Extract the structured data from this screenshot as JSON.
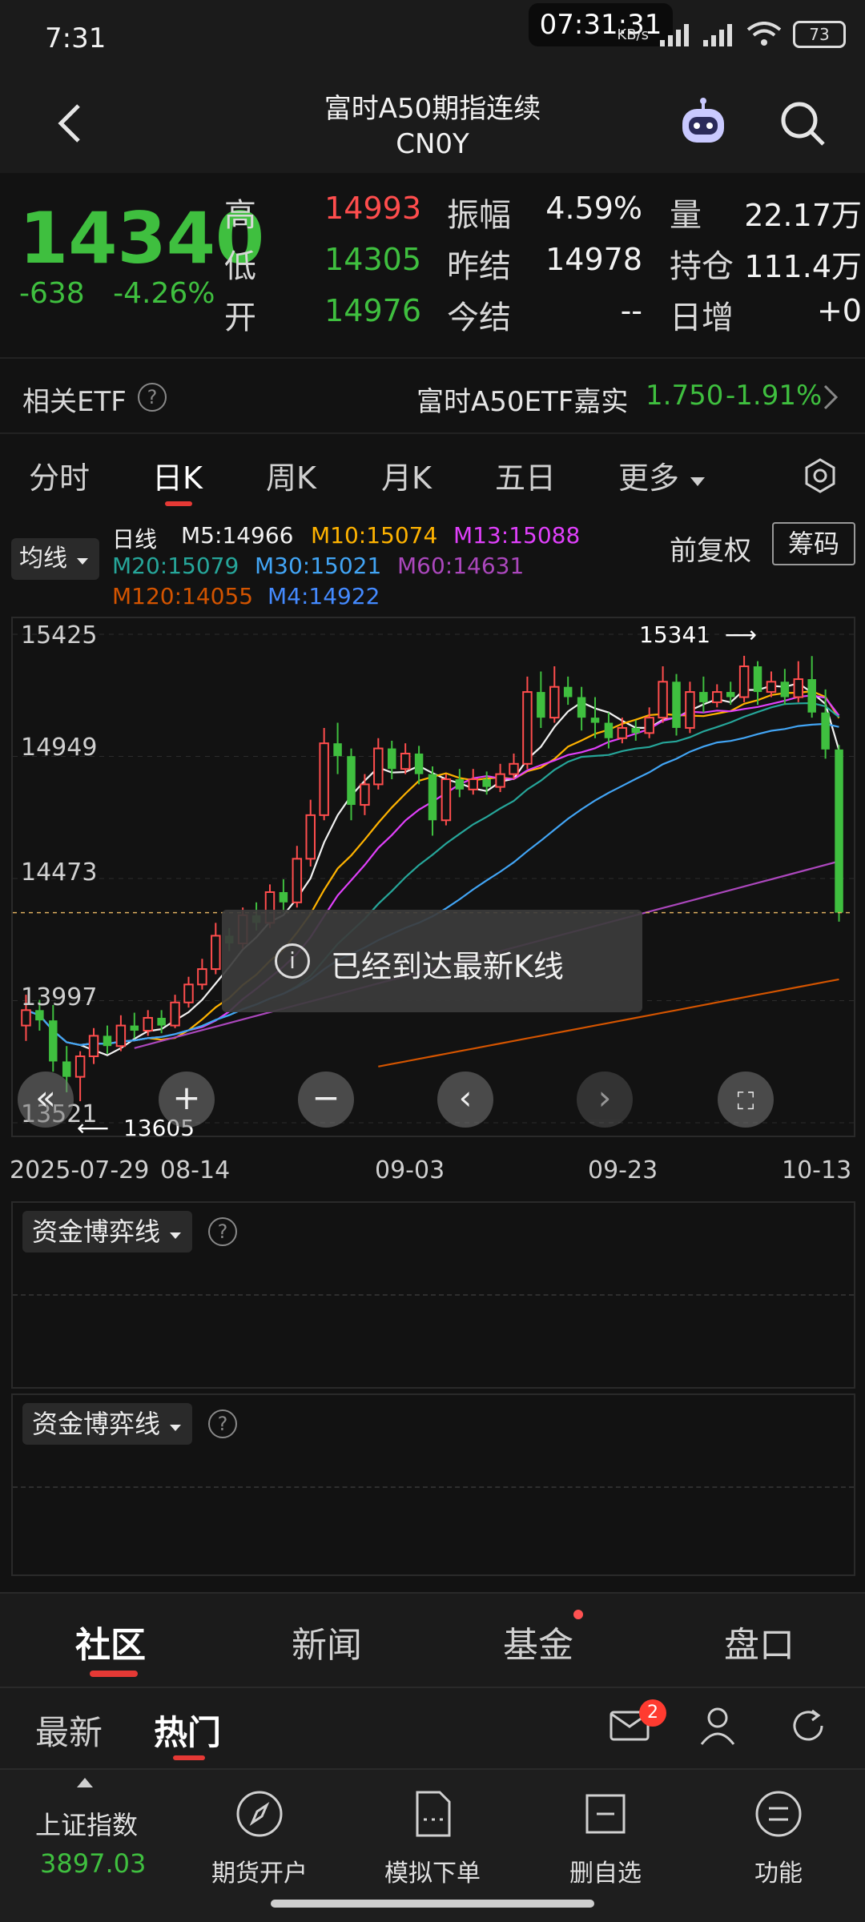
{
  "status": {
    "time": "7:31",
    "center_time": "07:31:31",
    "battery": "73",
    "net_speed": "KB/s"
  },
  "header": {
    "title": "富时A50期指连续",
    "subtitle": "CN0Y"
  },
  "quote": {
    "last": "14340",
    "change": "-638",
    "change_pct": "-4.26%",
    "high_label": "高",
    "high": "14993",
    "low_label": "低",
    "low": "14305",
    "open_label": "开",
    "open": "14976",
    "amp_label": "振幅",
    "amp": "4.59%",
    "prev_settle_label": "昨结",
    "prev_settle": "14978",
    "settle_label": "今结",
    "settle": "--",
    "vol_label": "量",
    "vol": "22.17万",
    "oi_label": "持仓",
    "oi": "111.4万",
    "oi_chg_label": "日增",
    "oi_chg": "+0"
  },
  "etf": {
    "label": "相关ETF",
    "name": "富时A50ETF嘉实",
    "price": "1.750",
    "pct": "-1.91%"
  },
  "tabs": [
    "分时",
    "日K",
    "周K",
    "月K",
    "五日",
    "更多"
  ],
  "chart": {
    "ma_dropdown": "均线",
    "legend_title": "日线",
    "ma": [
      {
        "label": "M5:14966",
        "color": "#f2f2f2"
      },
      {
        "label": "M10:15074",
        "color": "#ffb300"
      },
      {
        "label": "M13:15088",
        "color": "#e040fb"
      },
      {
        "label": "M20:15079",
        "color": "#26a69a"
      },
      {
        "label": "M30:15021",
        "color": "#42a5f5"
      },
      {
        "label": "M60:14631",
        "color": "#ab47bc"
      },
      {
        "label": "M120:14055",
        "color": "#d35400"
      },
      {
        "label": "M4:14922",
        "color": "#448aff"
      }
    ],
    "fuquan": "前复权",
    "chouma": "筹码",
    "high_marker": "15341",
    "low_marker": "13605",
    "toast": "已经到达最新K线"
  },
  "chart_data": {
    "type": "candlestick",
    "y_ticks": [
      "15425",
      "14949",
      "14473",
      "13997",
      "13521"
    ],
    "x_ticks": [
      "2025-07-29",
      "08-14",
      "09-03",
      "09-23",
      "10-13"
    ],
    "ylim": [
      13521,
      15425
    ],
    "candles": [
      {
        "o": 13900,
        "c": 13960,
        "h": 14020,
        "l": 13840
      },
      {
        "o": 13960,
        "c": 13920,
        "h": 14000,
        "l": 13880
      },
      {
        "o": 13920,
        "c": 13760,
        "h": 13980,
        "l": 13720
      },
      {
        "o": 13760,
        "c": 13700,
        "h": 13820,
        "l": 13640
      },
      {
        "o": 13700,
        "c": 13780,
        "h": 13800,
        "l": 13605
      },
      {
        "o": 13780,
        "c": 13860,
        "h": 13890,
        "l": 13750
      },
      {
        "o": 13860,
        "c": 13820,
        "h": 13900,
        "l": 13790
      },
      {
        "o": 13820,
        "c": 13900,
        "h": 13940,
        "l": 13800
      },
      {
        "o": 13900,
        "c": 13880,
        "h": 13950,
        "l": 13850
      },
      {
        "o": 13880,
        "c": 13930,
        "h": 13960,
        "l": 13860
      },
      {
        "o": 13930,
        "c": 13900,
        "h": 13960,
        "l": 13870
      },
      {
        "o": 13900,
        "c": 13990,
        "h": 14020,
        "l": 13890
      },
      {
        "o": 13990,
        "c": 14060,
        "h": 14090,
        "l": 13970
      },
      {
        "o": 14060,
        "c": 14120,
        "h": 14160,
        "l": 14040
      },
      {
        "o": 14120,
        "c": 14250,
        "h": 14300,
        "l": 14100
      },
      {
        "o": 14250,
        "c": 14220,
        "h": 14280,
        "l": 14190
      },
      {
        "o": 14220,
        "c": 14330,
        "h": 14360,
        "l": 14200
      },
      {
        "o": 14330,
        "c": 14300,
        "h": 14380,
        "l": 14270
      },
      {
        "o": 14300,
        "c": 14420,
        "h": 14450,
        "l": 14280
      },
      {
        "o": 14420,
        "c": 14380,
        "h": 14470,
        "l": 14340
      },
      {
        "o": 14380,
        "c": 14550,
        "h": 14600,
        "l": 14360
      },
      {
        "o": 14550,
        "c": 14720,
        "h": 14780,
        "l": 14520
      },
      {
        "o": 14720,
        "c": 15000,
        "h": 15060,
        "l": 14700
      },
      {
        "o": 15000,
        "c": 14950,
        "h": 15080,
        "l": 14880
      },
      {
        "o": 14950,
        "c": 14760,
        "h": 14980,
        "l": 14700
      },
      {
        "o": 14760,
        "c": 14840,
        "h": 14880,
        "l": 14720
      },
      {
        "o": 14840,
        "c": 14980,
        "h": 15020,
        "l": 14820
      },
      {
        "o": 14980,
        "c": 14900,
        "h": 15010,
        "l": 14860
      },
      {
        "o": 14900,
        "c": 14960,
        "h": 15000,
        "l": 14880
      },
      {
        "o": 14960,
        "c": 14880,
        "h": 14990,
        "l": 14840
      },
      {
        "o": 14880,
        "c": 14700,
        "h": 14910,
        "l": 14640
      },
      {
        "o": 14700,
        "c": 14860,
        "h": 14880,
        "l": 14680
      },
      {
        "o": 14860,
        "c": 14820,
        "h": 14900,
        "l": 14790
      },
      {
        "o": 14820,
        "c": 14860,
        "h": 14900,
        "l": 14800
      },
      {
        "o": 14860,
        "c": 14830,
        "h": 14890,
        "l": 14800
      },
      {
        "o": 14830,
        "c": 14880,
        "h": 14920,
        "l": 14810
      },
      {
        "o": 14880,
        "c": 14920,
        "h": 14960,
        "l": 14860
      },
      {
        "o": 14920,
        "c": 15200,
        "h": 15260,
        "l": 14900
      },
      {
        "o": 15200,
        "c": 15100,
        "h": 15280,
        "l": 15060
      },
      {
        "o": 15100,
        "c": 15220,
        "h": 15300,
        "l": 15080
      },
      {
        "o": 15220,
        "c": 15180,
        "h": 15260,
        "l": 15150
      },
      {
        "o": 15180,
        "c": 15100,
        "h": 15220,
        "l": 15050
      },
      {
        "o": 15100,
        "c": 15080,
        "h": 15180,
        "l": 15020
      },
      {
        "o": 15080,
        "c": 15020,
        "h": 15120,
        "l": 14980
      },
      {
        "o": 15020,
        "c": 15060,
        "h": 15100,
        "l": 15000
      },
      {
        "o": 15060,
        "c": 15040,
        "h": 15090,
        "l": 15010
      },
      {
        "o": 15040,
        "c": 15100,
        "h": 15140,
        "l": 15020
      },
      {
        "o": 15100,
        "c": 15240,
        "h": 15300,
        "l": 15080
      },
      {
        "o": 15240,
        "c": 15060,
        "h": 15270,
        "l": 15030
      },
      {
        "o": 15060,
        "c": 15200,
        "h": 15240,
        "l": 15040
      },
      {
        "o": 15200,
        "c": 15160,
        "h": 15260,
        "l": 15120
      },
      {
        "o": 15160,
        "c": 15200,
        "h": 15230,
        "l": 15140
      },
      {
        "o": 15200,
        "c": 15180,
        "h": 15240,
        "l": 15150
      },
      {
        "o": 15180,
        "c": 15300,
        "h": 15341,
        "l": 15160
      },
      {
        "o": 15300,
        "c": 15200,
        "h": 15320,
        "l": 15150
      },
      {
        "o": 15200,
        "c": 15240,
        "h": 15280,
        "l": 15180
      },
      {
        "o": 15240,
        "c": 15180,
        "h": 15290,
        "l": 15150
      },
      {
        "o": 15180,
        "c": 15250,
        "h": 15320,
        "l": 15160
      },
      {
        "o": 15250,
        "c": 15120,
        "h": 15340,
        "l": 15100
      },
      {
        "o": 15120,
        "c": 14976,
        "h": 15210,
        "l": 14940
      },
      {
        "o": 14976,
        "c": 14340,
        "h": 14993,
        "l": 14305
      }
    ]
  },
  "panels": [
    {
      "label": "资金博弈线"
    },
    {
      "label": "资金博弈线"
    }
  ],
  "bottom_tabs": [
    "社区",
    "新闻",
    "基金",
    "盘口"
  ],
  "sub_tabs": [
    "最新",
    "热门"
  ],
  "badge": "2",
  "nav": {
    "index_name": "上证指数",
    "index_value": "3897.03",
    "items": [
      "期货开户",
      "模拟下单",
      "删自选",
      "功能"
    ]
  }
}
